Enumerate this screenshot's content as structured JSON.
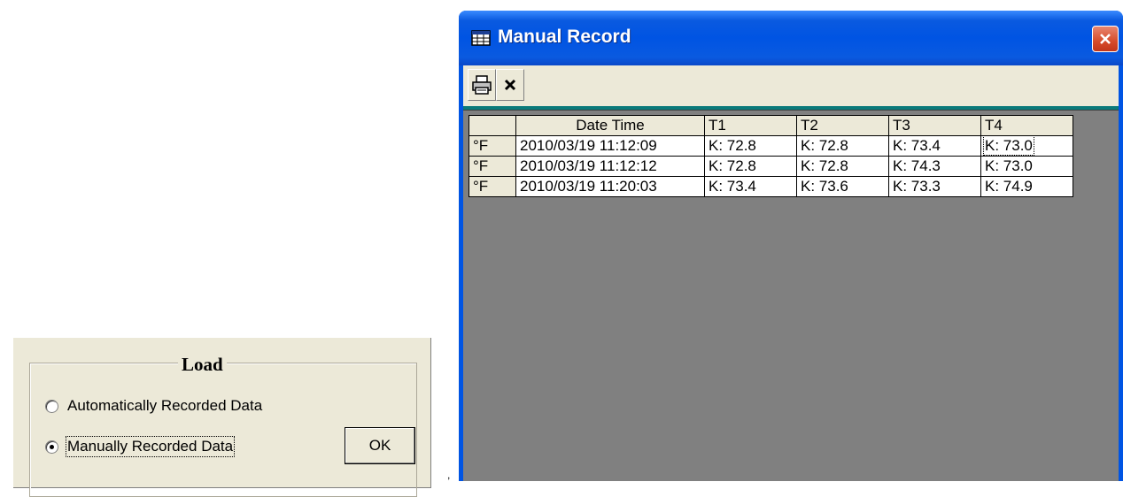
{
  "load_dialog": {
    "title": "Load",
    "options": [
      {
        "label": "Automatically Recorded Data",
        "selected": false
      },
      {
        "label": "Manually Recorded Data",
        "selected": true
      }
    ],
    "ok_label": "OK"
  },
  "manual_record": {
    "title": "Manual Record",
    "toolbar": {
      "print_icon": "printer-icon",
      "delete_icon": "delete-x-icon"
    },
    "columns": [
      "",
      "Date Time",
      "T1",
      "T2",
      "T3",
      "T4"
    ],
    "rows": [
      {
        "unit": "°F",
        "datetime": "2010/03/19 11:12:09",
        "t1": "K: 72.8",
        "t2": "K: 72.8",
        "t3": "K: 73.4",
        "t4": "K: 73.0"
      },
      {
        "unit": "°F",
        "datetime": "2010/03/19 11:12:12",
        "t1": "K: 72.8",
        "t2": "K: 72.8",
        "t3": "K: 74.3",
        "t4": "K: 73.0"
      },
      {
        "unit": "°F",
        "datetime": "2010/03/19 11:20:03",
        "t1": "K: 73.4",
        "t2": "K: 73.6",
        "t3": "K: 73.3",
        "t4": "K: 74.9"
      }
    ]
  },
  "colors": {
    "titlebar": "#0054e3",
    "grid_background": "#808080",
    "dialog_face": "#ece9d8",
    "close_button": "#d64b2b"
  }
}
